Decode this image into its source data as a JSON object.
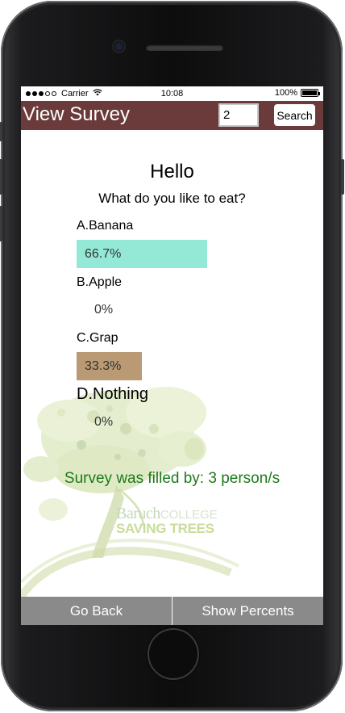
{
  "status": {
    "carrier": "Carrier",
    "time": "10:08",
    "battery": "100%"
  },
  "nav": {
    "title": "View Survey",
    "survey_id": "2",
    "search_label": "Search"
  },
  "survey": {
    "title": "Hello",
    "question": "What do you like to eat?",
    "options": [
      {
        "label": "A.Banana",
        "percent_text": "66.7%",
        "percent": 66.7,
        "bar_color": "#93e9d6"
      },
      {
        "label": "B.Apple",
        "percent_text": "0%",
        "percent": 0,
        "bar_color": "#ffffff"
      },
      {
        "label": "C.Grap",
        "percent_text": "33.3%",
        "percent": 33.3,
        "bar_color": "#b99a74"
      },
      {
        "label": "D.Nothing",
        "percent_text": "0%",
        "percent": 0,
        "bar_color": "#ffffff"
      }
    ],
    "filled_by": "Survey was filled by: 3 person/s"
  },
  "logo": {
    "line1_a": "Baruch",
    "line1_b": "COLLEGE",
    "line2": "SAVING TREES"
  },
  "footer": {
    "back_label": "Go Back",
    "percents_label": "Show Percents"
  },
  "colors": {
    "nav_bg": "#6b3a3a",
    "footer_bg": "#8a8a8a",
    "filled_text": "#1b7a1b"
  }
}
